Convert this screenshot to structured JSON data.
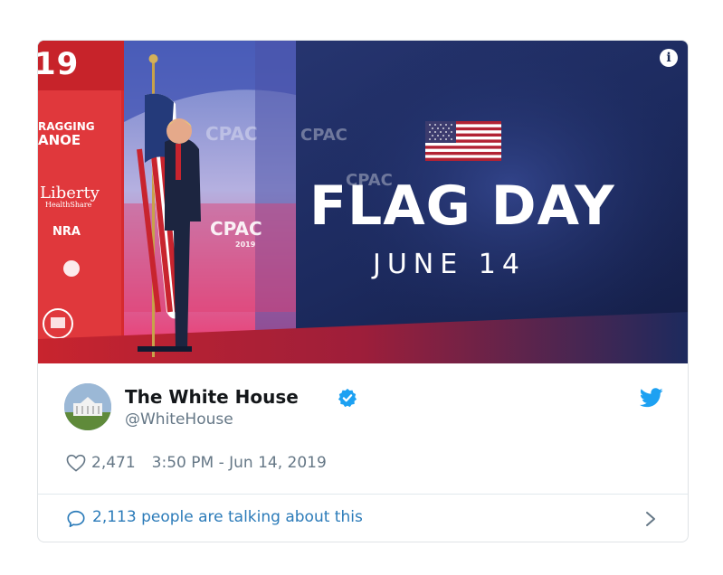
{
  "media": {
    "headline": "FLAG DAY",
    "date": "JUNE 14",
    "info_icon": "info-icon",
    "banner_year": "19",
    "sponsors": {
      "raging": "RAGGING",
      "canoe": "ANOE",
      "liberty": "Liberty",
      "liberty_sub": "HealthShare",
      "nra": "NRA"
    },
    "cpac_label": "CPAC",
    "cpac_year": "2019"
  },
  "tweet": {
    "display_name": "The White House",
    "handle": "@WhiteHouse",
    "likes": "2,471",
    "timestamp": "3:50 PM - Jun 14, 2019",
    "conversation": "2,113 people are talking about this"
  },
  "colors": {
    "twitter_blue": "#1da1f2",
    "link_blue": "#2b7bb9",
    "navy": "#1c2a5e",
    "cpac_red": "#d62a2e"
  }
}
